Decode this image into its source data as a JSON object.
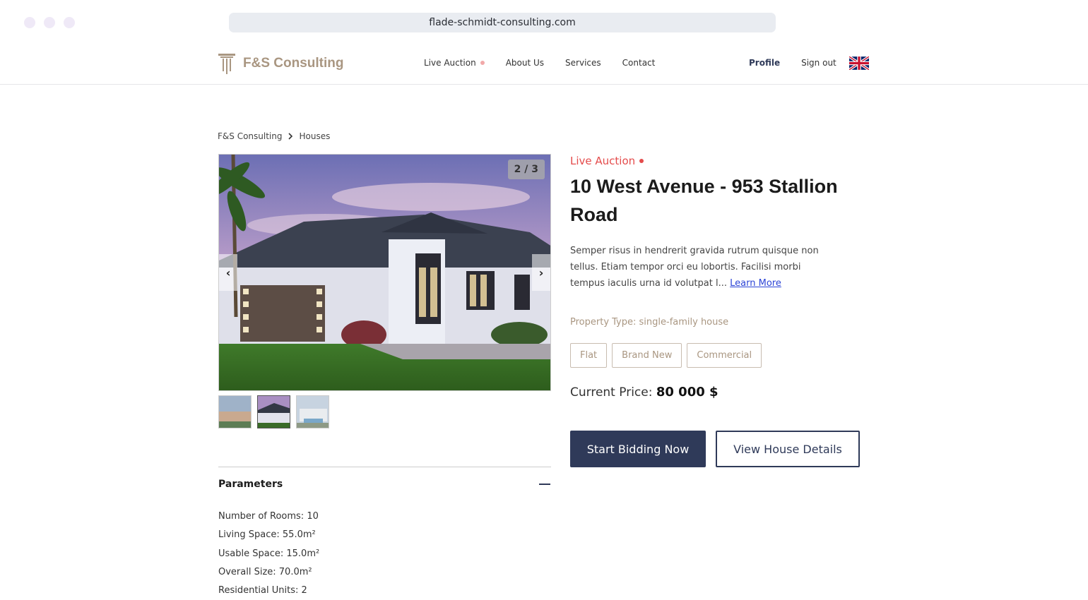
{
  "browser": {
    "url": "flade-schmidt-consulting.com"
  },
  "header": {
    "logo_text": "F&S Consulting",
    "nav": [
      {
        "label": "Live Auction"
      },
      {
        "label": "About Us"
      },
      {
        "label": "Services"
      },
      {
        "label": "Contact"
      }
    ],
    "profile_label": "Profile",
    "signout_label": "Sign out",
    "language_icon": "uk-flag-icon"
  },
  "breadcrumb": {
    "items": [
      "F&S Consulting",
      "Houses"
    ]
  },
  "gallery": {
    "counter": "2 / 3",
    "prev_icon": "chevron-left-icon",
    "next_icon": "chevron-right-icon",
    "thumbnail_count": 3,
    "active_thumbnail": 2
  },
  "property": {
    "status": "Live Auction",
    "title": "10 West Avenue - 953 Stallion Road",
    "description": "Semper risus in hendrerit gravida rutrum quisque non tellus. Etiam tempor orci eu lobortis. Facilisi morbi tempus iaculis urna id volutpat l...",
    "learn_more": "Learn More",
    "property_type": "Property Type: single-family house",
    "tags": [
      "Flat",
      "Brand New",
      "Commercial"
    ],
    "price_label": "Current Price:",
    "price_value": "80 000 $",
    "primary_button": "Start Bidding Now",
    "secondary_button": "View House Details"
  },
  "parameters": {
    "title": "Parameters",
    "items": [
      "Number of Rooms: 10",
      "Living Space: 55.0m²",
      "Usable Space: 15.0m²",
      "Overall Size: 70.0m²",
      "Residential Units: 2"
    ]
  },
  "colors": {
    "accent_dark": "#2f3a59",
    "brand_tan": "#a99681",
    "live_red": "#e44b4b"
  }
}
